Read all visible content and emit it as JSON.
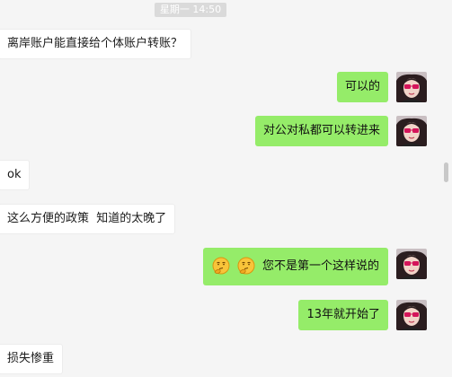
{
  "chat": {
    "timestamp": "星期一 14:50",
    "messages": [
      {
        "side": "in",
        "text": "离岸账户能直接给个体账户转账？"
      },
      {
        "side": "out",
        "text": "可以的"
      },
      {
        "side": "out",
        "text": "对公对私都可以转进来"
      },
      {
        "side": "in",
        "text": "ok"
      },
      {
        "side": "in",
        "text": "这么方便的政策  知道的太晚了"
      },
      {
        "side": "out",
        "text": "您不是第一个这样说的",
        "emoji": [
          "thinking-face-icon",
          "thinking-face-icon"
        ]
      },
      {
        "side": "out",
        "text": "13年就开始了"
      },
      {
        "side": "in",
        "text": "损失惨重"
      }
    ]
  },
  "colors": {
    "background": "#f5f5f5",
    "outgoing_bubble": "#95ec69",
    "incoming_bubble": "#ffffff",
    "timestamp_bg": "#dadada"
  }
}
